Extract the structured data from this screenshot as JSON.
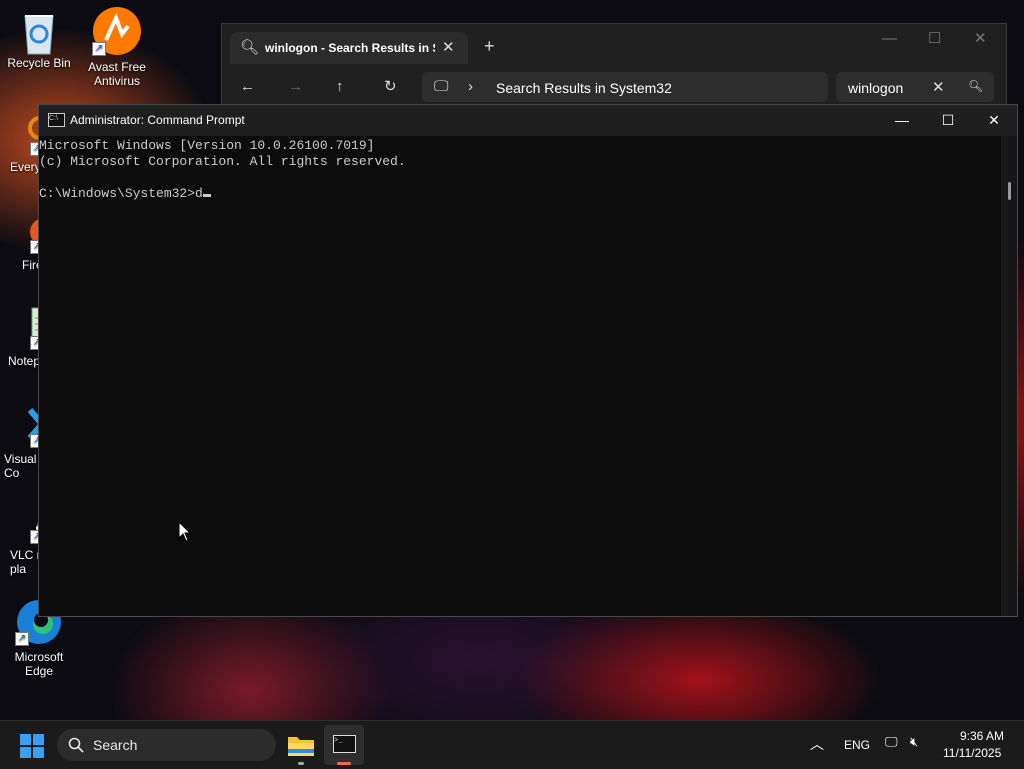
{
  "desktop": {
    "icons": [
      {
        "label": "Recycle Bin",
        "icon": "recycle-bin-icon"
      },
      {
        "label": "Avast Free\nAntivirus",
        "icon": "avast-icon"
      },
      {
        "label": "Every",
        "icon": "everything-icon"
      },
      {
        "label": "Fire",
        "icon": "firefox-icon"
      },
      {
        "label": "Notep",
        "icon": "notepad-icon"
      },
      {
        "label": "Visual\nCo",
        "icon": "vscode-icon"
      },
      {
        "label": "VLC r\npla",
        "icon": "vlc-icon"
      },
      {
        "label": "Microsoft\nEdge",
        "icon": "edge-icon"
      }
    ]
  },
  "explorer": {
    "tab_title": "winlogon - Search Results in S",
    "address_text": "Search Results in System32",
    "search_value": "winlogon"
  },
  "cmd": {
    "title": "Administrator: Command Prompt",
    "lines": [
      "Microsoft Windows [Version 10.0.26100.7019]",
      "(c) Microsoft Corporation. All rights reserved.",
      "",
      "C:\\Windows\\System32>d"
    ]
  },
  "taskbar": {
    "search_placeholder": "Search",
    "language": "ENG",
    "time": "9:36 AM",
    "date": "11/11/2025"
  },
  "colors": {
    "accent": "#3aa0f3",
    "console_bg": "#0c0c0c",
    "console_text": "#cccccc"
  }
}
